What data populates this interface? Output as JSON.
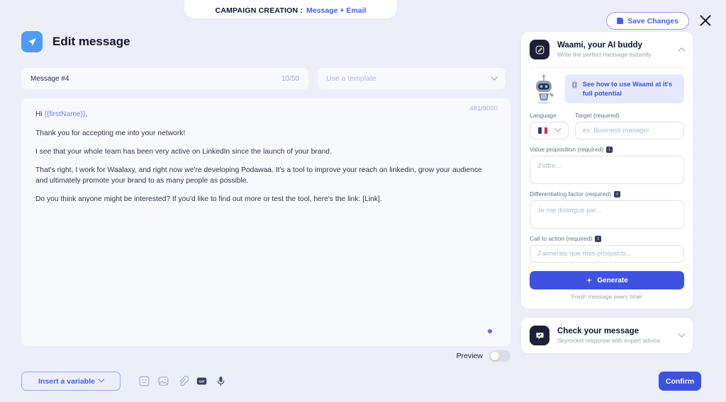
{
  "top_tab": {
    "label": "CAMPAIGN CREATION :",
    "value": "Message + Email"
  },
  "header": {
    "save_label": "Save Changes",
    "close_icon": "close-icon"
  },
  "editor_panel": {
    "title": "Edit message",
    "title_icon": "send-icon",
    "message_name": "Message #4",
    "name_counter": "10/50",
    "template_placeholder": "Use a template",
    "char_counter": "481/8000",
    "paragraphs": [
      {
        "prefix": "Hi ",
        "token": "{{firstName}}",
        "suffix": ","
      },
      {
        "prefix": "Thank you for accepting me into your network!",
        "token": "",
        "suffix": ""
      },
      {
        "prefix": "I see that your whole team has been very active on LinkedIn since the launch of your brand.",
        "token": "",
        "suffix": ""
      },
      {
        "prefix": "That's right, I work for Waalaxy, and right now we're developing Podawaa. It's a tool to improve your reach on linkedin, grow your audience and ultimately promote your brand to as many people as possible.",
        "token": "",
        "suffix": ""
      },
      {
        "prefix": "Do you think anyone might be interested? If you'd like to find out more or test the tool, here's the link: [Link].",
        "token": "",
        "suffix": ""
      }
    ]
  },
  "preview": {
    "label": "Preview",
    "enabled": false
  },
  "bottom_bar": {
    "insert_variable_label": "Insert a variable",
    "icons": [
      "emoji-icon",
      "image-icon",
      "attachment-icon",
      "gif-icon",
      "microphone-icon"
    ],
    "confirm_label": "Confirm"
  },
  "waami": {
    "title": "Waami, your AI buddy",
    "subtitle": "Write the perfect message instantly",
    "icon": "compose-icon",
    "collapse_icon": "chevron-up-icon",
    "avatar_icon": "robot-avatar-icon",
    "banner_icon": "info-book-icon",
    "banner_text": "See how to use Waami at it's full potential",
    "language_label": "Language",
    "language_flag": "flag-france",
    "target_label": "Target (required)",
    "target_placeholder": "ex: Business manager",
    "value_prop_label": "Value proposition (required)",
    "value_prop_placeholder": "J'offre...",
    "diff_label": "Differentiating factor (required)",
    "diff_placeholder": "Je me distingue par...",
    "cta_label": "Call to action (required)",
    "cta_placeholder": "J'aimerais que mes prospects...",
    "generate_label": "Generate",
    "generate_icon": "sparkle-icon",
    "generate_note": "Fresh message every time!"
  },
  "check_message": {
    "title": "Check your message",
    "subtitle": "Skyrocket response with expert advice",
    "icon": "chat-check-icon",
    "expand_icon": "chevron-down-icon"
  },
  "colors": {
    "accent": "#3f51e0",
    "link": "#4a5cf5",
    "page_bg": "#eceff9",
    "panel_bg": "#f8f9fd",
    "dark": "#1d2036"
  }
}
